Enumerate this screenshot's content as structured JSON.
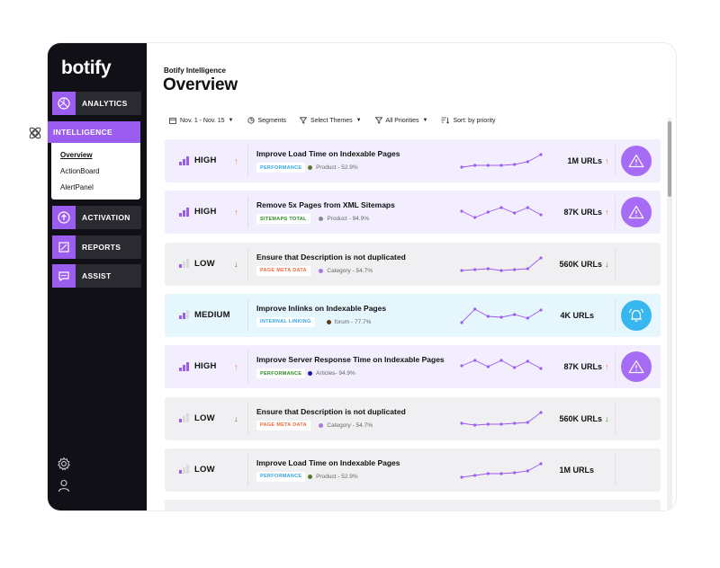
{
  "sidebar": {
    "logo": "botify",
    "nav": [
      {
        "label": "ANALYTICS",
        "icon": "analytics-icon"
      },
      {
        "label": "INTELLIGENCE",
        "icon": "intelligence-icon",
        "active": true
      },
      {
        "label": "ACTIVATION",
        "icon": "activation-icon"
      },
      {
        "label": "REPORTS",
        "icon": "reports-icon"
      },
      {
        "label": "ASSIST",
        "icon": "assist-icon"
      }
    ],
    "subnav": [
      "Overview",
      "ActionBoard",
      "AlertPanel"
    ],
    "bottom_icons": [
      "settings-icon",
      "user-icon"
    ]
  },
  "header": {
    "breadcrumb": "Botify Intelligence",
    "title": "Overview"
  },
  "filters": {
    "date": "Nov. 1 - Nov. 15",
    "segments": "Segments",
    "themes": "Select Themes",
    "priorities": "All Priorities",
    "sort": "Sort: by priority"
  },
  "colors": {
    "accent": "#9b5cf0",
    "high_row": "#f3eefe",
    "low_row": "#f0f0f2",
    "medium_row": "#e6f6fd",
    "alert_purple": "#a66cf5",
    "alert_blue": "#38b6f0",
    "arrow_up": "#f07a3a",
    "arrow_down": "#2e8b22",
    "tag_performance": "#32a6e8",
    "tag_sitemaps": "#2e8b22",
    "tag_pagemeta": "#f06a3a",
    "tag_linking": "#32a6e8"
  },
  "rows": [
    {
      "priority": "HIGH",
      "level": 3,
      "trend": "up",
      "title": "Improve Load Time on Indexable Pages",
      "tag": "PERFORMANCE",
      "tag_color": "#32a6e8",
      "meta": "Product - 52.9%",
      "meta_dot": "#5a7a2a",
      "urls": "1M URLs",
      "urls_trend": "up",
      "bg": "#f3eefe",
      "alert": "warning",
      "spark": [
        0.15,
        0.25,
        0.25,
        0.25,
        0.3,
        0.45,
        0.85
      ]
    },
    {
      "priority": "HIGH",
      "level": 3,
      "trend": "up",
      "title": "Remove 5x Pages from XML Sitemaps",
      "tag": "SITEMAPS TOTAL",
      "tag_color": "#2e8b22",
      "meta": "Product - 94.9%",
      "meta_dot": "#8a8a8a",
      "urls": "87K URLs",
      "urls_trend": "up",
      "bg": "#f3eefe",
      "alert": "warning",
      "spark": [
        0.55,
        0.2,
        0.5,
        0.75,
        0.45,
        0.75,
        0.35
      ]
    },
    {
      "priority": "LOW",
      "level": 1,
      "trend": "down",
      "title": "Ensure that Description is not duplicated",
      "tag": "PAGE META DATA",
      "tag_color": "#f06a3a",
      "meta": "Category - 54.7%",
      "meta_dot": "#a97be0",
      "urls": "560K URLs",
      "urls_trend": "down",
      "bg": "#f0f0f2",
      "alert": "",
      "spark": [
        0.15,
        0.2,
        0.25,
        0.15,
        0.2,
        0.25,
        0.85
      ]
    },
    {
      "priority": "MEDIUM",
      "level": 2,
      "trend": "",
      "title": "Improve Inlinks on Indexable Pages",
      "tag": "INTERNAL LINKING",
      "tag_color": "#32a6e8",
      "meta": "forum - 77.7%",
      "meta_dot": "#5a3a1a",
      "urls": "4K URLs",
      "urls_trend": "",
      "bg": "#e6f6fd",
      "alert": "bell",
      "spark": [
        0.1,
        0.85,
        0.45,
        0.4,
        0.55,
        0.35,
        0.8
      ]
    },
    {
      "priority": "HIGH",
      "level": 3,
      "trend": "up",
      "title": "Improve Server Response Time on Indexable Pages",
      "tag": "PERFORMANCE",
      "tag_color": "#2e8b22",
      "meta": "Articles- 94.9%",
      "meta_dot": "#1a1ab0",
      "urls": "87K URLs",
      "urls_trend": "up",
      "bg": "#f3eefe",
      "alert": "warning",
      "spark": [
        0.55,
        0.85,
        0.5,
        0.85,
        0.45,
        0.8,
        0.4
      ]
    },
    {
      "priority": "LOW",
      "level": 1,
      "trend": "down",
      "title": "Ensure that Description is not duplicated",
      "tag": "PAGE META DATA",
      "tag_color": "#f06a3a",
      "meta": "Category - 54.7%",
      "meta_dot": "#a97be0",
      "urls": "560K URLs",
      "urls_trend": "down",
      "bg": "#f0f0f2",
      "alert": "",
      "spark": [
        0.25,
        0.15,
        0.2,
        0.2,
        0.25,
        0.3,
        0.85
      ]
    },
    {
      "priority": "LOW",
      "level": 1,
      "trend": "",
      "title": "Improve Load Time on Indexable Pages",
      "tag": "PERFORMANCE",
      "tag_color": "#32a6e8",
      "meta": "Product - 52.9%",
      "meta_dot": "#5a7a2a",
      "urls": "1M URLs",
      "urls_trend": "",
      "bg": "#f0f0f2",
      "alert": "",
      "spark": [
        0.1,
        0.2,
        0.3,
        0.3,
        0.35,
        0.45,
        0.85
      ]
    },
    {
      "priority": "",
      "level": 0,
      "trend": "",
      "title": "",
      "tag": "",
      "tag_color": "#32a6e8",
      "meta": "",
      "meta_dot": "#f0f0f2",
      "urls": "",
      "urls_trend": "",
      "bg": "#f0f0f2",
      "alert": "",
      "spark": []
    }
  ]
}
